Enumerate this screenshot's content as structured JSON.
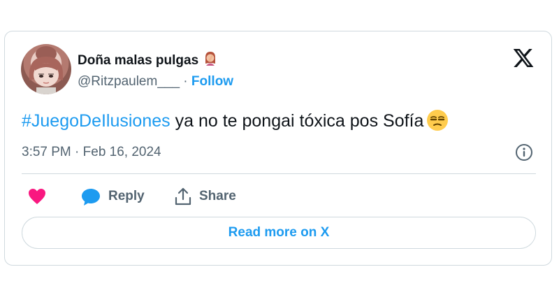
{
  "tweet": {
    "author_name": "Doña malas pulgas",
    "author_emoji": "🤦‍♀️",
    "handle": "@Ritzpaulem___",
    "separator": " · ",
    "follow_label": "Follow",
    "hashtag": "#JuegoDeIlusiones",
    "text": " ya no te pongai tóxica pos Sofía",
    "text_emoji": "😒",
    "timestamp": "3:57 PM · Feb 16, 2024"
  },
  "actions": {
    "like_icon": "heart-icon",
    "reply_label": "Reply",
    "share_label": "Share"
  },
  "read_more_label": "Read more on X",
  "colors": {
    "accent": "#1d9bf0",
    "like": "#f91880",
    "text_primary": "#0f1419",
    "text_secondary": "#536471",
    "border": "#cfd9de"
  }
}
